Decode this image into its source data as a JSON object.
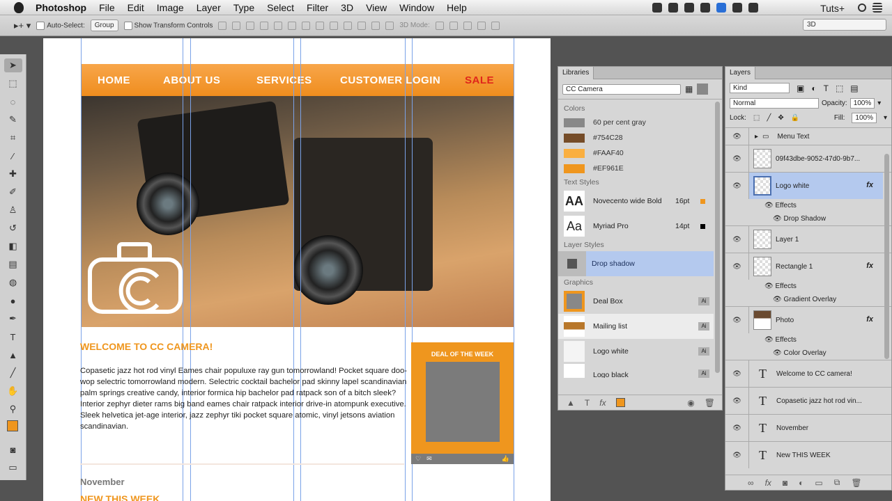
{
  "menubar": {
    "app": "Photoshop",
    "items": [
      "File",
      "Edit",
      "Image",
      "Layer",
      "Type",
      "Select",
      "Filter",
      "3D",
      "View",
      "Window",
      "Help"
    ],
    "right_label": "Tuts+"
  },
  "options": {
    "auto_select": "Auto-Select:",
    "group": "Group",
    "show_transform": "Show Transform Controls",
    "mode_3d": "3D Mode:",
    "workspace": "3D"
  },
  "canvas": {
    "nav": [
      "HOME",
      "ABOUT US",
      "SERVICES",
      "CUSTOMER LOGIN",
      "SALE"
    ],
    "welcome": "WELCOME TO CC CAMERA!",
    "body": "Copasetic jazz hot rod vinyl Eames chair populuxe ray gun tomorrowland! Pocket square doo-wop selectric tomorrowland modern. Selectric cocktail bachelor pad skinny lapel scandinavian palm springs creative candy, interior formica hip bachelor pad ratpack son of a bitch sleek? Interior zephyr dieter rams big band eames chair ratpack interior drive-in atompunk executive. Sleek helvetica jet-age interior, jazz zephyr tiki pocket square atomic, vinyl jetsons aviation scandinavian.",
    "month": "November",
    "new_week": "NEW THIS WEEK",
    "deal_title": "DEAL OF THE WEEK",
    "colors": {
      "orange": "#ef961e",
      "sale": "#e0261b"
    }
  },
  "libraries": {
    "tab": "Libraries",
    "library": "CC Camera",
    "colors_header": "Colors",
    "colors": [
      {
        "name": "60 per cent gray",
        "hex": "#888888"
      },
      {
        "name": "#754C28",
        "hex": "#754C28"
      },
      {
        "name": "#FAAF40",
        "hex": "#FAAF40"
      },
      {
        "name": "#EF961E",
        "hex": "#EF961E"
      }
    ],
    "text_styles_header": "Text Styles",
    "text_styles": [
      {
        "preview": "AA",
        "name": "Novecento wide Bold",
        "size": "16pt",
        "color": "#ef961e"
      },
      {
        "preview": "Aa",
        "name": "Myriad Pro",
        "size": "14pt",
        "color": "#000000"
      }
    ],
    "layer_styles_header": "Layer Styles",
    "layer_styles": [
      "Drop shadow"
    ],
    "graphics_header": "Graphics",
    "graphics": [
      "Deal Box",
      "Mailing list",
      "Logo white",
      "Logo black"
    ],
    "ai_badge": "Ai"
  },
  "layers": {
    "tab": "Layers",
    "filter": "Kind",
    "blend": "Normal",
    "opacity_label": "Opacity:",
    "opacity": "100%",
    "lock_label": "Lock:",
    "fill_label": "Fill:",
    "fill": "100%",
    "effects_label": "Effects",
    "items": [
      {
        "name": "Menu Text"
      },
      {
        "name": "09f43dbe-9052-47d0-9b7..."
      },
      {
        "name": "Logo white",
        "effect": "Drop Shadow"
      },
      {
        "name": "Layer 1"
      },
      {
        "name": "Rectangle 1",
        "effect": "Gradient Overlay"
      },
      {
        "name": "Photo",
        "effect": "Color Overlay"
      },
      {
        "name": "Welcome to CC camera!"
      },
      {
        "name": "Copasetic jazz hot rod vin..."
      },
      {
        "name": "November"
      },
      {
        "name": "New THIS WEEK"
      }
    ]
  }
}
